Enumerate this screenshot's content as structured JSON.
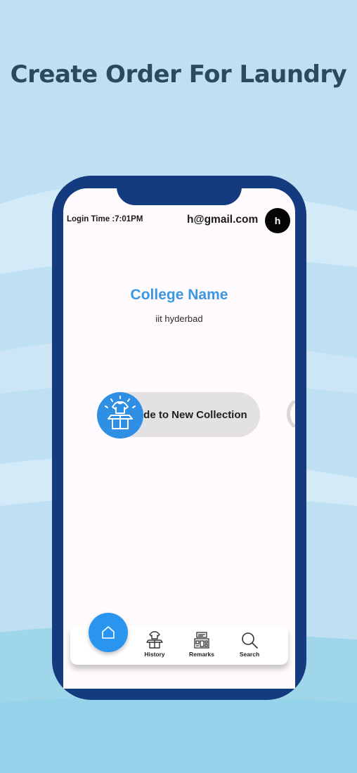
{
  "headline": "Create Order For Laundry",
  "header": {
    "login_time": "Login Time :7:01PM",
    "email": "h@gmail.com",
    "avatar_initial": "h"
  },
  "college": {
    "title": "College Name",
    "value": "iit hyderbad"
  },
  "slider": {
    "label": "Slide to New Collection",
    "visible_label": "ide to New Collection",
    "knob_icon": "laundry-box-icon"
  },
  "bottom_nav": {
    "home_icon": "home-icon",
    "items": [
      {
        "label": "History",
        "icon": "laundry-box-icon"
      },
      {
        "label": "Remarks",
        "icon": "remarks-icon"
      },
      {
        "label": "Search",
        "icon": "search-icon"
      }
    ]
  },
  "colors": {
    "background": "#bfe0f2",
    "phone_frame": "#143a7f",
    "accent": "#2f8fe4",
    "headline": "#294b5c"
  }
}
